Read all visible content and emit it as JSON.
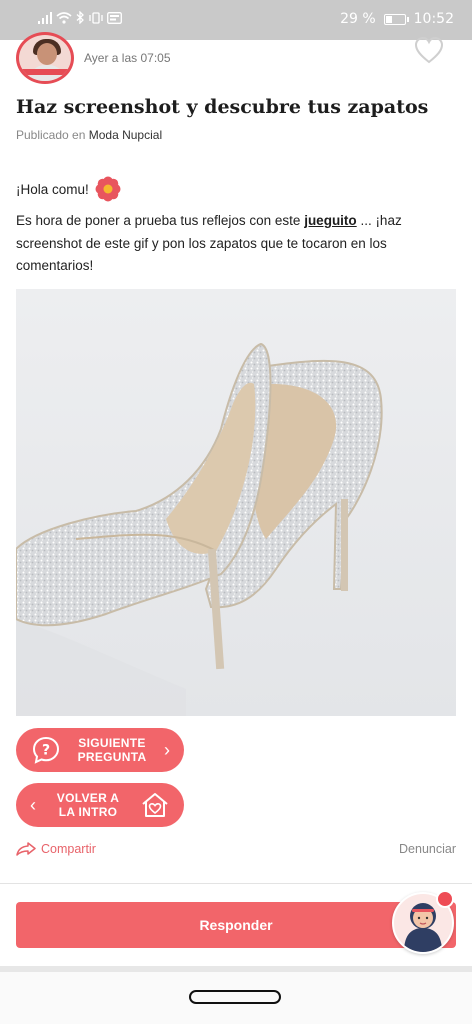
{
  "status_bar": {
    "battery": "29 %",
    "time": "10:52"
  },
  "post": {
    "time": "Ayer a las 07:05",
    "title": "Haz screenshot y descubre tus zapatos",
    "published_prefix": "Publicado en",
    "category": "Moda Nupcial",
    "greeting": "¡Hola comu!",
    "body_before_link": "Es hora de poner a prueba tus reflejos con este ",
    "body_link": "jueguito",
    "body_after_link": " ... ¡haz screenshot de este gif y pon los zapatos que te tocaron en los comentarios!"
  },
  "buttons": {
    "next_line1": "SIGUIENTE",
    "next_line2": "PREGUNTA",
    "back_line1": "VOLVER A",
    "back_line2": "LA INTRO",
    "share": "Compartir",
    "report": "Denunciar",
    "reply": "Responder"
  },
  "colors": {
    "accent": "#f2656a",
    "brand_red": "#e64c55"
  }
}
